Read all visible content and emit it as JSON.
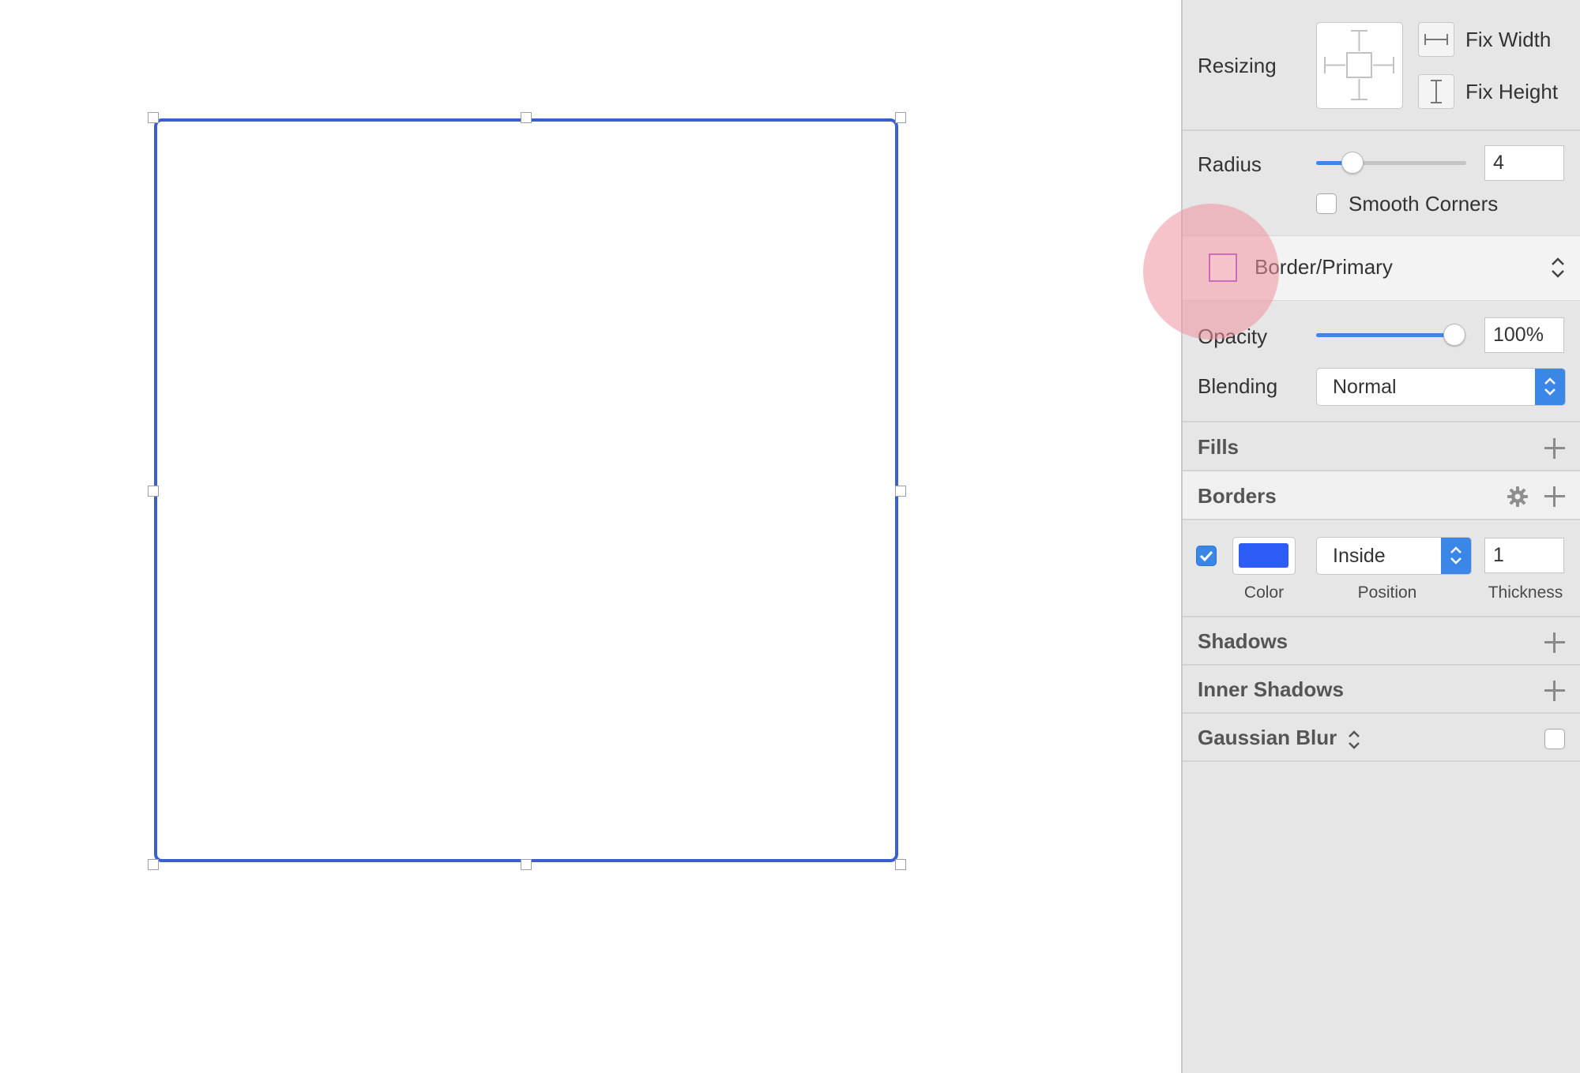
{
  "inspector": {
    "resizing": {
      "label": "Resizing",
      "fix_width_label": "Fix Width",
      "fix_height_label": "Fix Height"
    },
    "radius": {
      "label": "Radius",
      "value": "4",
      "slider_fraction": 0.24,
      "smooth_corners_label": "Smooth Corners",
      "smooth_corners_checked": false
    },
    "style": {
      "name": "Border/Primary",
      "swatch_color": "#9b3fd8"
    },
    "opacity": {
      "label": "Opacity",
      "value": "100%",
      "slider_fraction": 1.0
    },
    "blending": {
      "label": "Blending",
      "value": "Normal"
    },
    "fills": {
      "label": "Fills"
    },
    "borders": {
      "label": "Borders",
      "enabled": true,
      "color": "#2d5cf6",
      "position_value": "Inside",
      "thickness_value": "1",
      "color_caption": "Color",
      "position_caption": "Position",
      "thickness_caption": "Thickness"
    },
    "shadows": {
      "label": "Shadows"
    },
    "inner_shadows": {
      "label": "Inner Shadows"
    },
    "gaussian_blur": {
      "label": "Gaussian Blur",
      "enabled": false
    }
  },
  "canvas": {
    "shape_border_color": "#3b5fd0"
  },
  "highlight_color": "#f1929f",
  "accent_color": "#3b87e8"
}
